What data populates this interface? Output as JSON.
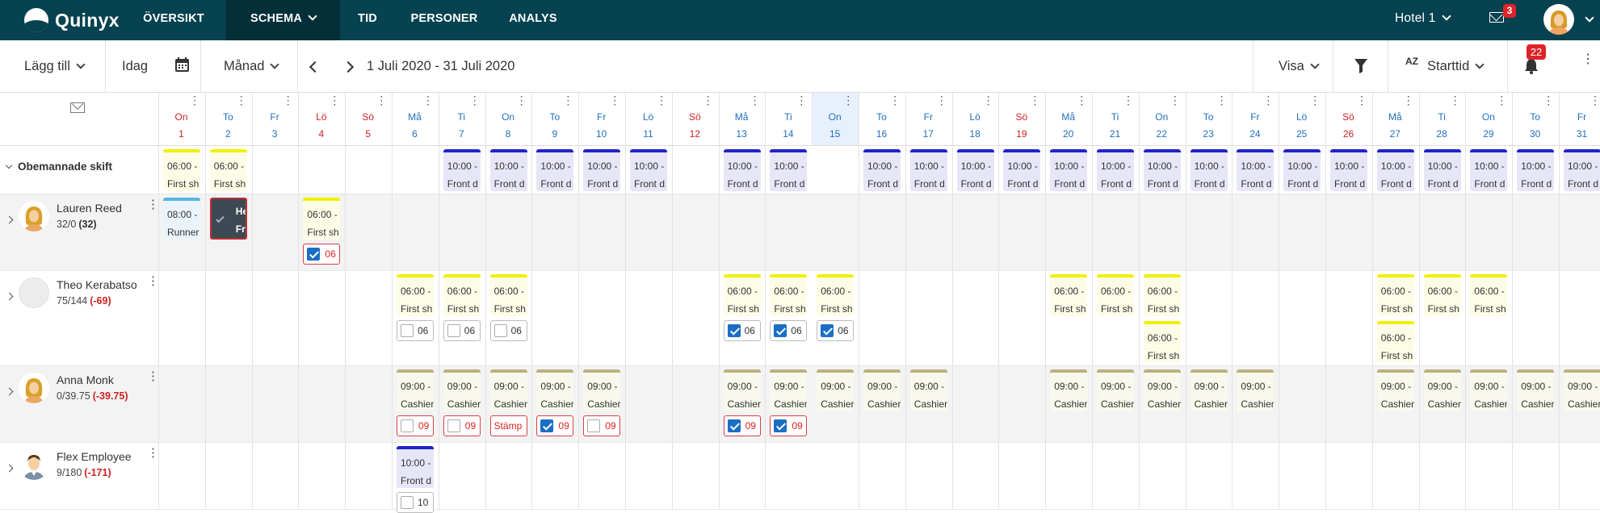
{
  "app": {
    "logo_text": "Quinyx"
  },
  "nav": {
    "items": [
      {
        "label": "ÖVERSIKT",
        "name": "nav-oversikt"
      },
      {
        "label": "SCHEMA",
        "name": "nav-schema"
      },
      {
        "label": "TID",
        "name": "nav-tid"
      },
      {
        "label": "PERSONER",
        "name": "nav-personer"
      },
      {
        "label": "ANALYS",
        "name": "nav-analys"
      }
    ],
    "unit": "Hotel 1",
    "mail_count": "3"
  },
  "toolbar": {
    "add_label": "Lägg till",
    "today_label": "Idag",
    "view_mode": "Månad",
    "date_range": "1 Juli 2020 - 31 Juli 2020",
    "show_label": "Visa",
    "sort_label": "Starttid",
    "sort_icon_text": "AZ",
    "notification_count": "22"
  },
  "colors": {
    "weekend_red": "#cc2222",
    "weekday_blue": "#1f6fbf",
    "today_bg": "#e8f0fb",
    "nav_bg": "#06424f"
  },
  "days": [
    {
      "wd": "On",
      "d": "1",
      "we": true
    },
    {
      "wd": "To",
      "d": "2"
    },
    {
      "wd": "Fr",
      "d": "3"
    },
    {
      "wd": "Lö",
      "d": "4",
      "we": true
    },
    {
      "wd": "Sö",
      "d": "5",
      "we": true
    },
    {
      "wd": "Må",
      "d": "6"
    },
    {
      "wd": "Ti",
      "d": "7"
    },
    {
      "wd": "On",
      "d": "8"
    },
    {
      "wd": "To",
      "d": "9"
    },
    {
      "wd": "Fr",
      "d": "10"
    },
    {
      "wd": "Lö",
      "d": "11"
    },
    {
      "wd": "Sö",
      "d": "12",
      "we": true
    },
    {
      "wd": "Må",
      "d": "13"
    },
    {
      "wd": "Ti",
      "d": "14"
    },
    {
      "wd": "On",
      "d": "15",
      "today": true
    },
    {
      "wd": "To",
      "d": "16"
    },
    {
      "wd": "Fr",
      "d": "17"
    },
    {
      "wd": "Lö",
      "d": "18"
    },
    {
      "wd": "Sö",
      "d": "19",
      "we": true
    },
    {
      "wd": "Må",
      "d": "20"
    },
    {
      "wd": "Ti",
      "d": "21"
    },
    {
      "wd": "On",
      "d": "22"
    },
    {
      "wd": "To",
      "d": "23"
    },
    {
      "wd": "Fr",
      "d": "24"
    },
    {
      "wd": "Lö",
      "d": "25"
    },
    {
      "wd": "Sö",
      "d": "26",
      "we": true
    },
    {
      "wd": "Må",
      "d": "27"
    },
    {
      "wd": "Ti",
      "d": "28"
    },
    {
      "wd": "On",
      "d": "29"
    },
    {
      "wd": "To",
      "d": "30"
    },
    {
      "wd": "Fr",
      "d": "31"
    }
  ],
  "unassigned": {
    "label": "Obemannade skift",
    "shifts": [
      {
        "day": 1,
        "t": "06:00 -",
        "n": "First sh",
        "c": "yellow"
      },
      {
        "day": 2,
        "t": "06:00 -",
        "n": "First sh",
        "c": "yellow"
      },
      {
        "day": 7,
        "t": "10:00 -",
        "n": "Front d",
        "c": "blue"
      },
      {
        "day": 8,
        "t": "10:00 -",
        "n": "Front d",
        "c": "blue"
      },
      {
        "day": 9,
        "t": "10:00 -",
        "n": "Front d",
        "c": "blue"
      },
      {
        "day": 10,
        "t": "10:00 -",
        "n": "Front d",
        "c": "blue"
      },
      {
        "day": 11,
        "t": "10:00 -",
        "n": "Front d",
        "c": "blue"
      },
      {
        "day": 13,
        "t": "10:00 -",
        "n": "Front d",
        "c": "blue"
      },
      {
        "day": 14,
        "t": "10:00 -",
        "n": "Front d",
        "c": "blue"
      },
      {
        "day": 16,
        "t": "10:00 -",
        "n": "Front d",
        "c": "blue"
      },
      {
        "day": 17,
        "t": "10:00 -",
        "n": "Front d",
        "c": "blue"
      },
      {
        "day": 18,
        "t": "10:00 -",
        "n": "Front d",
        "c": "blue"
      },
      {
        "day": 19,
        "t": "10:00 -",
        "n": "Front d",
        "c": "blue"
      },
      {
        "day": 20,
        "t": "10:00 -",
        "n": "Front d",
        "c": "blue"
      },
      {
        "day": 21,
        "t": "10:00 -",
        "n": "Front d",
        "c": "blue"
      },
      {
        "day": 22,
        "t": "10:00 -",
        "n": "Front d",
        "c": "blue"
      },
      {
        "day": 23,
        "t": "10:00 -",
        "n": "Front d",
        "c": "blue"
      },
      {
        "day": 24,
        "t": "10:00 -",
        "n": "Front d",
        "c": "blue"
      },
      {
        "day": 25,
        "t": "10:00 -",
        "n": "Front d",
        "c": "blue"
      },
      {
        "day": 26,
        "t": "10:00 -",
        "n": "Front d",
        "c": "blue"
      },
      {
        "day": 27,
        "t": "10:00 -",
        "n": "Front d",
        "c": "blue"
      },
      {
        "day": 28,
        "t": "10:00 -",
        "n": "Front d",
        "c": "blue"
      },
      {
        "day": 29,
        "t": "10:00 -",
        "n": "Front d",
        "c": "blue"
      },
      {
        "day": 30,
        "t": "10:00 -",
        "n": "Front d",
        "c": "blue"
      },
      {
        "day": 31,
        "t": "10:00 -",
        "n": "Front d",
        "c": "blue"
      }
    ]
  },
  "employees": [
    {
      "name": "Lauren Reed",
      "hours": "32/0",
      "diff": "(32)",
      "diff_red": false,
      "avatar": "woman",
      "shifts": [
        {
          "day": 1,
          "slot": 0,
          "t": "08:00 -",
          "n": "Runner",
          "c": "cyan"
        },
        {
          "day": 2,
          "slot": 0,
          "t": "He",
          "n": "Fr",
          "c": "dark"
        },
        {
          "day": 4,
          "slot": 0,
          "t": "06:00 -",
          "n": "First sh",
          "c": "yellow"
        }
      ],
      "stamps": [
        {
          "day": 4,
          "slot": 0,
          "checked": true,
          "red": true,
          "text": "06"
        }
      ]
    },
    {
      "name": "Theo Kerabatso",
      "hours": "75/144",
      "diff": "(-69)",
      "diff_red": true,
      "avatar": "blank",
      "shifts": [
        {
          "day": 6,
          "slot": 0,
          "t": "06:00 -",
          "n": "First sh",
          "c": "yellow"
        },
        {
          "day": 7,
          "slot": 0,
          "t": "06:00 -",
          "n": "First sh",
          "c": "yellow"
        },
        {
          "day": 8,
          "slot": 0,
          "t": "06:00 -",
          "n": "First sh",
          "c": "yellow"
        },
        {
          "day": 13,
          "slot": 0,
          "t": "06:00 -",
          "n": "First sh",
          "c": "yellow"
        },
        {
          "day": 14,
          "slot": 0,
          "t": "06:00 -",
          "n": "First sh",
          "c": "yellow"
        },
        {
          "day": 15,
          "slot": 0,
          "t": "06:00 -",
          "n": "First sh",
          "c": "yellow"
        },
        {
          "day": 20,
          "slot": 0,
          "t": "06:00 -",
          "n": "First sh",
          "c": "yellow"
        },
        {
          "day": 21,
          "slot": 0,
          "t": "06:00 -",
          "n": "First sh",
          "c": "yellow"
        },
        {
          "day": 22,
          "slot": 0,
          "t": "06:00 -",
          "n": "First sh",
          "c": "yellow"
        },
        {
          "day": 22,
          "slot": 1,
          "t": "06:00 -",
          "n": "First sh",
          "c": "yellow"
        },
        {
          "day": 27,
          "slot": 0,
          "t": "06:00 -",
          "n": "First sh",
          "c": "yellow"
        },
        {
          "day": 27,
          "slot": 1,
          "t": "06:00 -",
          "n": "First sh",
          "c": "yellow"
        },
        {
          "day": 28,
          "slot": 0,
          "t": "06:00 -",
          "n": "First sh",
          "c": "yellow"
        },
        {
          "day": 29,
          "slot": 0,
          "t": "06:00 -",
          "n": "First sh",
          "c": "yellow"
        }
      ],
      "stamps": [
        {
          "day": 6,
          "slot": 0,
          "checked": false,
          "red": false,
          "text": "06"
        },
        {
          "day": 7,
          "slot": 0,
          "checked": false,
          "red": false,
          "text": "06"
        },
        {
          "day": 8,
          "slot": 0,
          "checked": false,
          "red": false,
          "text": "06"
        },
        {
          "day": 13,
          "slot": 0,
          "checked": true,
          "red": false,
          "text": "06"
        },
        {
          "day": 14,
          "slot": 0,
          "checked": true,
          "red": false,
          "text": "06"
        },
        {
          "day": 15,
          "slot": 0,
          "checked": true,
          "red": false,
          "text": "06"
        }
      ]
    },
    {
      "name": "Anna Monk",
      "hours": "0/39.75",
      "diff": "(-39.75)",
      "diff_red": true,
      "avatar": "woman",
      "shifts": [
        {
          "day": 6,
          "slot": 0,
          "t": "09:00 -",
          "n": "Cashier",
          "c": "olive"
        },
        {
          "day": 7,
          "slot": 0,
          "t": "09:00 -",
          "n": "Cashier",
          "c": "olive"
        },
        {
          "day": 8,
          "slot": 0,
          "t": "09:00 -",
          "n": "Cashier",
          "c": "olive"
        },
        {
          "day": 9,
          "slot": 0,
          "t": "09:00 -",
          "n": "Cashier",
          "c": "olive"
        },
        {
          "day": 10,
          "slot": 0,
          "t": "09:00 -",
          "n": "Cashier",
          "c": "olive"
        },
        {
          "day": 13,
          "slot": 0,
          "t": "09:00 -",
          "n": "Cashier",
          "c": "olive"
        },
        {
          "day": 14,
          "slot": 0,
          "t": "09:00 -",
          "n": "Cashier",
          "c": "olive"
        },
        {
          "day": 15,
          "slot": 0,
          "t": "09:00 -",
          "n": "Cashier",
          "c": "olive"
        },
        {
          "day": 16,
          "slot": 0,
          "t": "09:00 -",
          "n": "Cashier",
          "c": "olive"
        },
        {
          "day": 17,
          "slot": 0,
          "t": "09:00 -",
          "n": "Cashier",
          "c": "olive"
        },
        {
          "day": 20,
          "slot": 0,
          "t": "09:00 -",
          "n": "Cashier",
          "c": "olive"
        },
        {
          "day": 21,
          "slot": 0,
          "t": "09:00 -",
          "n": "Cashier",
          "c": "olive"
        },
        {
          "day": 22,
          "slot": 0,
          "t": "09:00 -",
          "n": "Cashier",
          "c": "olive"
        },
        {
          "day": 23,
          "slot": 0,
          "t": "09:00 -",
          "n": "Cashier",
          "c": "olive"
        },
        {
          "day": 24,
          "slot": 0,
          "t": "09:00 -",
          "n": "Cashier",
          "c": "olive"
        },
        {
          "day": 27,
          "slot": 0,
          "t": "09:00 -",
          "n": "Cashier",
          "c": "olive"
        },
        {
          "day": 28,
          "slot": 0,
          "t": "09:00 -",
          "n": "Cashier",
          "c": "olive"
        },
        {
          "day": 29,
          "slot": 0,
          "t": "09:00 -",
          "n": "Cashier",
          "c": "olive"
        },
        {
          "day": 30,
          "slot": 0,
          "t": "09:00 -",
          "n": "Cashier",
          "c": "olive"
        },
        {
          "day": 31,
          "slot": 0,
          "t": "09:00 -",
          "n": "Cashier",
          "c": "olive"
        }
      ],
      "stamps": [
        {
          "day": 6,
          "slot": 0,
          "checked": false,
          "red": true,
          "text": "09"
        },
        {
          "day": 7,
          "slot": 0,
          "checked": false,
          "red": true,
          "text": "09"
        },
        {
          "day": 8,
          "slot": 0,
          "checked": null,
          "red": true,
          "text": "Stämp"
        },
        {
          "day": 9,
          "slot": 0,
          "checked": true,
          "red": true,
          "text": "09"
        },
        {
          "day": 10,
          "slot": 0,
          "checked": false,
          "red": true,
          "text": "09"
        },
        {
          "day": 13,
          "slot": 0,
          "checked": true,
          "red": true,
          "text": "09"
        },
        {
          "day": 14,
          "slot": 0,
          "checked": true,
          "red": true,
          "text": "09"
        }
      ]
    },
    {
      "name": "Flex Employee",
      "hours": "9/180",
      "diff": "(-171)",
      "diff_red": true,
      "avatar": "man",
      "shifts": [
        {
          "day": 6,
          "slot": 0,
          "t": "10:00 -",
          "n": "Front d",
          "c": "blue"
        }
      ],
      "stamps": [
        {
          "day": 6,
          "slot": 0,
          "checked": false,
          "red": false,
          "text": "10"
        }
      ]
    }
  ]
}
